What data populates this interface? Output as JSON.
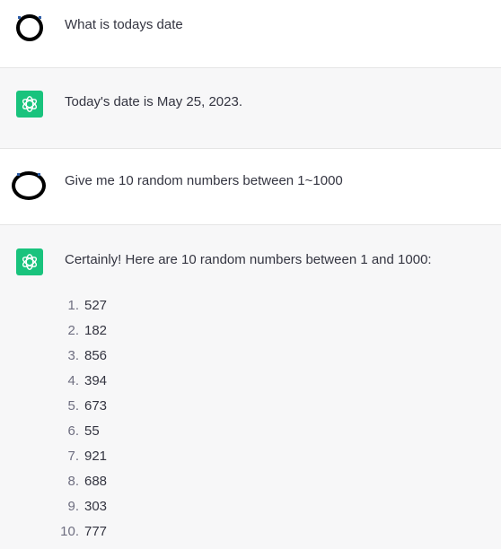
{
  "messages": [
    {
      "role": "user",
      "text": "What is todays date"
    },
    {
      "role": "assistant",
      "text": "Today's date is May 25, 2023."
    },
    {
      "role": "user",
      "text": "Give me 10 random numbers between 1~1000"
    },
    {
      "role": "assistant",
      "text": "Certainly! Here are 10 random numbers between 1 and 1000:",
      "list": [
        {
          "index": "1.",
          "value": "527"
        },
        {
          "index": "2.",
          "value": "182"
        },
        {
          "index": "3.",
          "value": "856"
        },
        {
          "index": "4.",
          "value": "394"
        },
        {
          "index": "5.",
          "value": "673"
        },
        {
          "index": "6.",
          "value": "55"
        },
        {
          "index": "7.",
          "value": "921"
        },
        {
          "index": "8.",
          "value": "688"
        },
        {
          "index": "9.",
          "value": "303"
        },
        {
          "index": "10.",
          "value": "777"
        }
      ]
    }
  ],
  "icons": {
    "user_avatar": "user-avatar-icon",
    "assistant_avatar": "openai-logo-icon"
  },
  "colors": {
    "assistant_background": "#f7f7f8",
    "user_background": "#ffffff",
    "logo_background": "#19c37d",
    "text": "#343541",
    "list_number": "#6e6e80"
  }
}
